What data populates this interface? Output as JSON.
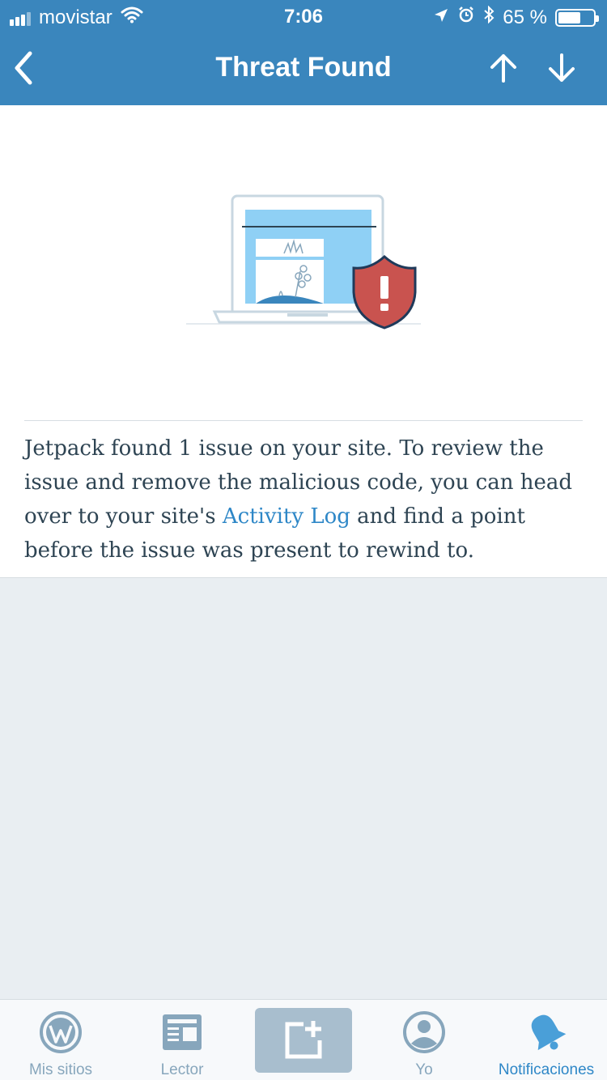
{
  "status_bar": {
    "carrier": "movistar",
    "time": "7:06",
    "battery_percent": "65 %",
    "battery_level": 0.65,
    "signal_bars_filled": 3,
    "icons": [
      "signal-icon",
      "wifi-icon",
      "location-icon",
      "alarm-icon",
      "bluetooth-icon",
      "battery-icon"
    ]
  },
  "nav": {
    "title": "Threat Found",
    "back_icon": "chevron-left-icon",
    "up_icon": "arrow-up-icon",
    "down_icon": "arrow-down-icon"
  },
  "threat": {
    "illustration_icon": "laptop-shield-warning-icon",
    "message_before": "Jetpack found 1 issue on your site. To review the issue and remove the malicious code, you can head over to your site's ",
    "link_text": "Activity Log",
    "message_after": " and find a point before the issue was present to rewind to."
  },
  "tabs": [
    {
      "label": "Mis sitios",
      "icon": "wordpress-icon",
      "active": false
    },
    {
      "label": "Lector",
      "icon": "reader-icon",
      "active": false
    },
    {
      "label": "",
      "icon": "new-post-icon",
      "active": false
    },
    {
      "label": "Yo",
      "icon": "profile-icon",
      "active": false
    },
    {
      "label": "Notificaciones",
      "icon": "bell-icon",
      "active": true
    }
  ],
  "colors": {
    "brand_blue": "#3a86bd",
    "link_blue": "#2e87c7",
    "text_dark": "#2e4453",
    "tab_gray": "#87a6bc",
    "shield_red": "#c9534f",
    "background_gray": "#e9eef2"
  }
}
